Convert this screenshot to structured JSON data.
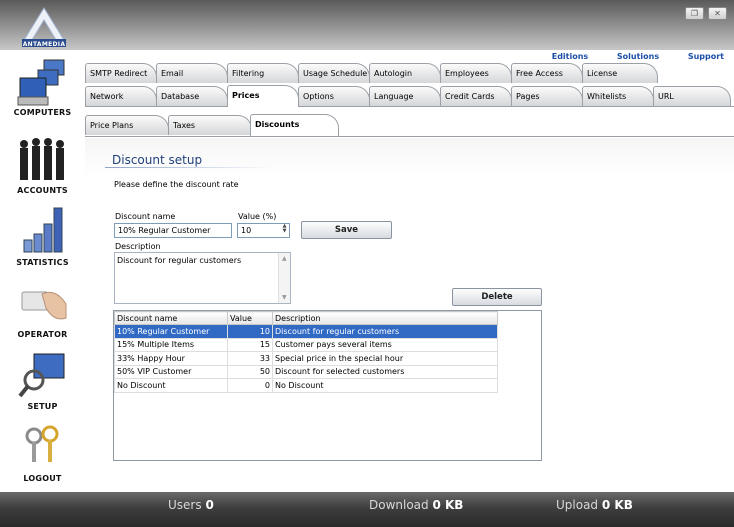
{
  "app": {
    "logo_text": "ANTAMEDIA"
  },
  "window_buttons": {
    "restore": "❐",
    "close": "✕"
  },
  "sidebar": {
    "items": [
      {
        "label": "COMPUTERS",
        "icon": "computers-icon"
      },
      {
        "label": "ACCOUNTS",
        "icon": "accounts-icon"
      },
      {
        "label": "STATISTICS",
        "icon": "statistics-icon"
      },
      {
        "label": "OPERATOR",
        "icon": "operator-icon"
      },
      {
        "label": "SETUP",
        "icon": "setup-icon"
      },
      {
        "label": "LOGOUT",
        "icon": "logout-icon"
      }
    ]
  },
  "top_links": {
    "editions": "Editions",
    "solutions": "Solutions",
    "support": "Support"
  },
  "tabs_row1": [
    "SMTP Redirect",
    "Email",
    "Filtering",
    "Usage Schedule",
    "Autologin",
    "Employees",
    "Free Access",
    "License"
  ],
  "tabs_row2": [
    "Network",
    "Database",
    "Prices",
    "Options",
    "Language",
    "Credit Cards",
    "Pages",
    "Whitelists",
    "URL"
  ],
  "tabs_row3": [
    "Price Plans",
    "Taxes",
    "Discounts"
  ],
  "active": {
    "row2": "Prices",
    "row3": "Discounts"
  },
  "form": {
    "title": "Discount setup",
    "subtitle": "Please define the discount rate",
    "name_label": "Discount name",
    "name_value": "10% Regular Customer",
    "value_label": "Value (%)",
    "value_value": "10",
    "description_label": "Description",
    "description_value": "Discount for regular customers",
    "save_label": "Save",
    "delete_label": "Delete"
  },
  "table": {
    "headers": [
      "Discount name",
      "Value",
      "Description"
    ],
    "rows": [
      {
        "name": "10% Regular Customer",
        "value": "10",
        "description": "Discount for regular customers",
        "selected": true
      },
      {
        "name": "15% Multiple Items",
        "value": "15",
        "description": "Customer pays several items"
      },
      {
        "name": "33% Happy Hour",
        "value": "33",
        "description": "Special price in the special hour"
      },
      {
        "name": "50% VIP Customer",
        "value": "50",
        "description": "Discount for selected customers"
      },
      {
        "name": "No Discount",
        "value": "0",
        "description": "No Discount"
      }
    ]
  },
  "status": {
    "users_label": "Users",
    "users_value": "0",
    "download_label": "Download",
    "download_value": "0 KB",
    "upload_label": "Upload",
    "upload_value": "0 KB"
  },
  "colors": {
    "accent": "#316ac5",
    "link": "#1d4fa8",
    "title": "#1f3f7a"
  }
}
